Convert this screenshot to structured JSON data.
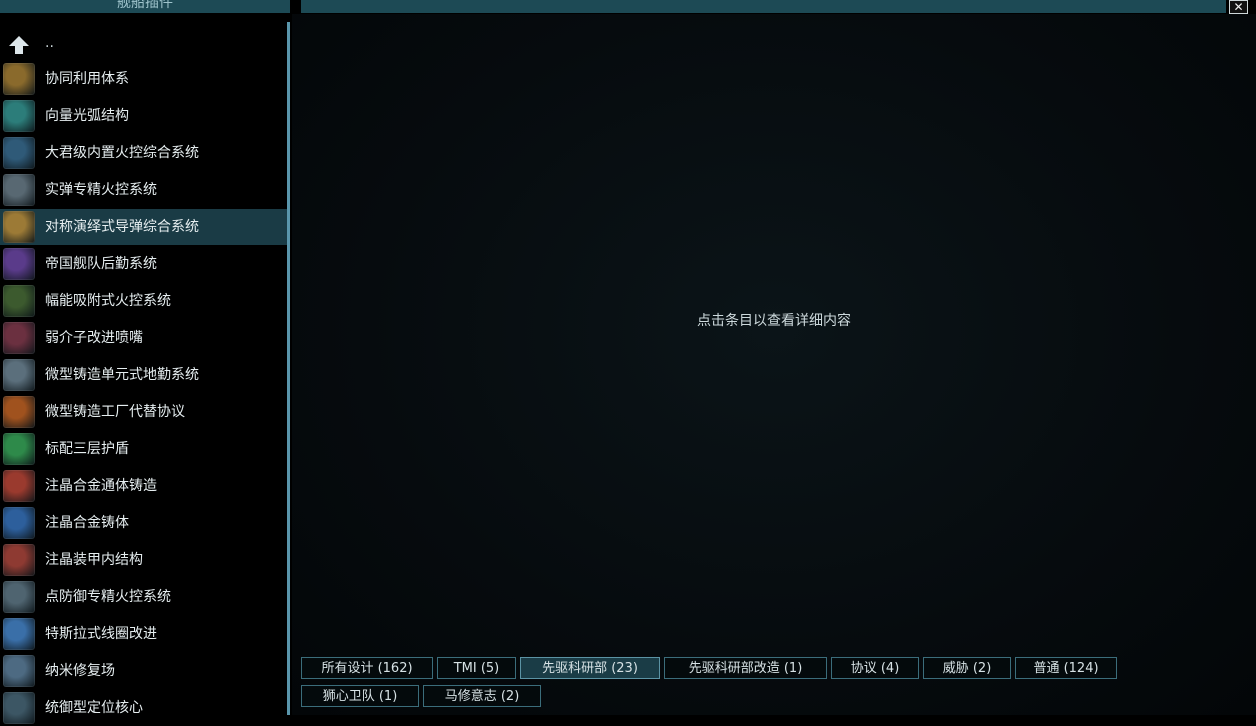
{
  "window": {
    "title": "舰船插件",
    "close_glyph": "✕"
  },
  "sidebar": {
    "up_label": "..",
    "items": [
      {
        "label": "协同利用体系",
        "icon": "gold-coil-icon",
        "color": "#8a6a2c"
      },
      {
        "label": "向量光弧结构",
        "icon": "teal-arc-icon",
        "color": "#2c7d7a"
      },
      {
        "label": "大君级内置火控综合系统",
        "icon": "blue-grid-icon",
        "color": "#2f5a78"
      },
      {
        "label": "实弹专精火控系统",
        "icon": "grey-launcher-icon",
        "color": "#586872"
      },
      {
        "label": "对称演绎式导弹综合系统",
        "icon": "missile-rack-icon",
        "color": "#9c7a36"
      },
      {
        "label": "帝国舰队后勤系统",
        "icon": "purple-cell-icon",
        "color": "#5a3b8a"
      },
      {
        "label": "幅能吸附式火控系统",
        "icon": "green-sparks-icon",
        "color": "#3c5a2e"
      },
      {
        "label": "弱介子改进喷嘴",
        "icon": "red-nozzle-icon",
        "color": "#6b3040"
      },
      {
        "label": "微型铸造单元式地勤系统",
        "icon": "striped-panel-icon",
        "color": "#5b6f7c"
      },
      {
        "label": "微型铸造工厂代替协议",
        "icon": "fire-forge-icon",
        "color": "#a0521e"
      },
      {
        "label": "标配三层护盾",
        "icon": "green-shield-icon",
        "color": "#2e8a4a"
      },
      {
        "label": "注晶合金通体铸造",
        "icon": "red-armor-plate-icon",
        "color": "#9a3a2e"
      },
      {
        "label": "注晶合金铸体",
        "icon": "blue-armor-plate-icon",
        "color": "#2d5f9c"
      },
      {
        "label": "注晶装甲内结构",
        "icon": "red-armor-frame-icon",
        "color": "#8e3a32"
      },
      {
        "label": "点防御专精火控系统",
        "icon": "turret-icon",
        "color": "#4f6470"
      },
      {
        "label": "特斯拉式线圈改进",
        "icon": "tesla-coil-icon",
        "color": "#3a6fa8"
      },
      {
        "label": "纳米修复场",
        "icon": "nano-field-icon",
        "color": "#4d6a82"
      },
      {
        "label": "统御型定位核心",
        "icon": "core-icon",
        "color": "#3c5664"
      }
    ],
    "selected_index": 4
  },
  "main": {
    "hint": "点击条目以查看详细内容"
  },
  "filters": [
    {
      "label": "所有设计 (162)"
    },
    {
      "label": "TMI (5)"
    },
    {
      "label": "先驱科研部 (23)"
    },
    {
      "label": "先驱科研部改造 (1)"
    },
    {
      "label": "协议 (4)"
    },
    {
      "label": "威胁 (2)"
    },
    {
      "label": "普通 (124)"
    },
    {
      "label": "狮心卫队 (1)"
    },
    {
      "label": "马修意志 (2)"
    }
  ],
  "active_filter_index": 2
}
